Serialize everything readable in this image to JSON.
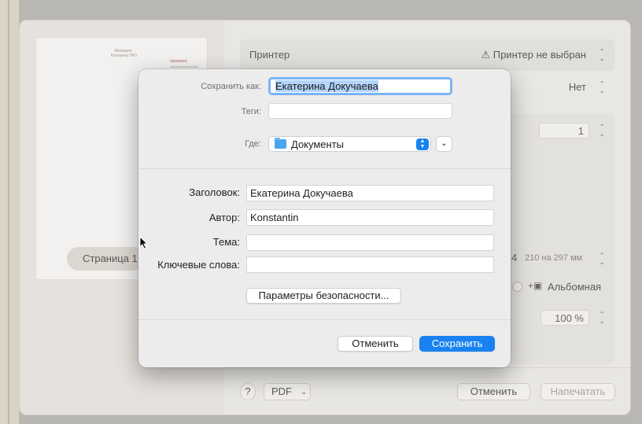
{
  "print_panel": {
    "preview": {
      "page_title_lines": [
        "Мемория",
        "Катерина ПКЛ"
      ],
      "page_note": "проверка",
      "page_indicator": "Страница 1"
    },
    "printer_label": "Принтер",
    "printer_value": "Принтер не выбран",
    "presets_value": "Нет",
    "copies_value": "1",
    "paper_size_partial": "4",
    "paper_size_dims": "210 на 297 мм",
    "orientation_label": "Альбомная",
    "scale_value": "100 %",
    "footer": {
      "help_label": "?",
      "pdf_label": "PDF",
      "cancel_label": "Отменить",
      "print_label": "Напечатать"
    }
  },
  "save_dialog": {
    "save_as_label": "Сохранить как:",
    "save_as_value": "Екатерина Докучаева",
    "tags_label": "Теги:",
    "tags_value": "",
    "where_label": "Где:",
    "where_value": "Документы",
    "metadata": {
      "title_label": "Заголовок:",
      "title_value": "Екатерина Докучаева",
      "author_label": "Автор:",
      "author_value": "Konstantin",
      "subject_label": "Тема:",
      "subject_value": "",
      "keywords_label": "Ключевые слова:",
      "keywords_value": ""
    },
    "security_button": "Параметры безопасности...",
    "cancel_button": "Отменить",
    "save_button": "Сохранить"
  },
  "colors": {
    "accent": "#1a82f0",
    "focus_ring": "#7ab4f5",
    "selection": "#b3d4fc",
    "dialog_bg": "#ececec"
  },
  "icons": [
    "warning-icon",
    "folder-icon",
    "chevron-down-icon",
    "updown-chevron-icon",
    "stepper-icon",
    "landscape-orientation-icon",
    "help-icon",
    "pointer-cursor-icon"
  ]
}
